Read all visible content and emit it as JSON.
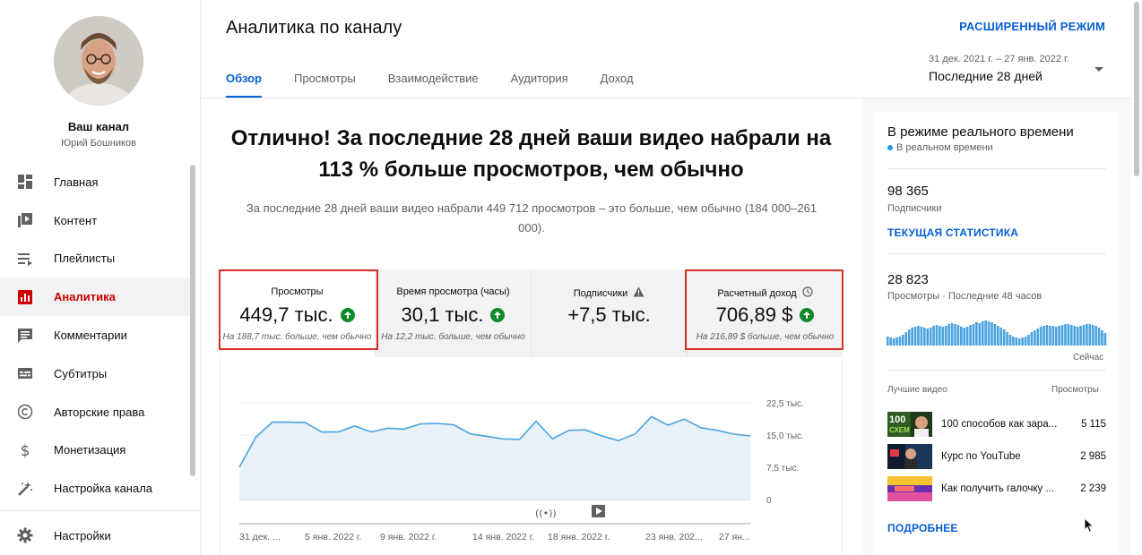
{
  "channel": {
    "title": "Ваш канал",
    "owner": "Юрий Бошников"
  },
  "sidebar": {
    "items": [
      {
        "label": "Главная",
        "icon": "dashboard-icon"
      },
      {
        "label": "Контент",
        "icon": "video-library-icon"
      },
      {
        "label": "Плейлисты",
        "icon": "playlist-icon"
      },
      {
        "label": "Аналитика",
        "icon": "analytics-icon",
        "active": true
      },
      {
        "label": "Комментарии",
        "icon": "comment-icon"
      },
      {
        "label": "Субтитры",
        "icon": "subtitles-icon"
      },
      {
        "label": "Авторские права",
        "icon": "copyright-icon"
      },
      {
        "label": "Монетизация",
        "icon": "dollar-icon"
      },
      {
        "label": "Настройка канала",
        "icon": "magic-wand-icon"
      }
    ],
    "settings_label": "Настройки"
  },
  "header": {
    "title": "Аналитика по каналу",
    "advanced_mode": "РАСШИРЕННЫЙ РЕЖИМ",
    "tabs": [
      "Обзор",
      "Просмотры",
      "Взаимодействие",
      "Аудитория",
      "Доход"
    ],
    "date_range": "31 дек. 2021 г. – 27 янв. 2022 г.",
    "date_preset": "Последние 28 дней"
  },
  "summary": {
    "headline": "Отлично! За последние 28 дней ваши видео набрали на 113 % больше просмотров, чем обычно",
    "subline": "За последние 28 дней ваши видео набрали 449 712 просмотров – это больше, чем обычно (184 000–261 000)."
  },
  "metrics": [
    {
      "title": "Просмотры",
      "value": "449,7 тыс.",
      "note": "На 188,7 тыс. больше, чем обычно",
      "trend": "up"
    },
    {
      "title": "Время просмотра (часы)",
      "value": "30,1 тыс.",
      "note": "На 12,2 тыс. больше, чем обычно",
      "trend": "up"
    },
    {
      "title": "Подписчики",
      "value": "+7,5 тыс.",
      "note": "",
      "trend": "none",
      "icon": "warning-icon"
    },
    {
      "title": "Расчетный доход",
      "value": "706,89 $",
      "note": "На 216,89 $ больше, чем обычно",
      "trend": "up",
      "icon": "clock-icon"
    }
  ],
  "chart_data": {
    "type": "area",
    "x": [
      "31 дек. ...",
      "5 янв. 2022 г.",
      "9 янв. 2022 г.",
      "14 янв. 2022 г.",
      "18 янв. 2022 г.",
      "23 янв. 202...",
      "27 ян..."
    ],
    "y_ticks": [
      "22,5 тыс.",
      "15,0 тыс.",
      "7,5 тыс.",
      "0"
    ],
    "ylim": [
      0,
      22500
    ],
    "series": [
      {
        "values": [
          7500,
          14500,
          18000,
          18000,
          17900,
          15700,
          15700,
          17100,
          15700,
          16600,
          16400,
          17600,
          17700,
          17400,
          15300,
          14700,
          14100,
          14000,
          18200,
          14100,
          16100,
          16200,
          14800,
          13700,
          15200,
          19300,
          17300,
          18700,
          16700,
          16100,
          15200,
          14800
        ],
        "color": "#4aa3df"
      }
    ],
    "grid": true
  },
  "realtime": {
    "title": "В режиме реального времени",
    "live_label": "В реальном времени",
    "subscribers_value": "98 365",
    "subscribers_label": "Подписчики",
    "current_stats_link": "ТЕКУЩАЯ СТАТИСТИКА",
    "views_value": "28 823",
    "views_label": "Просмотры · Последние 48 часов",
    "now_label": "Сейчас",
    "bars": [
      10,
      9,
      8,
      9,
      10,
      12,
      15,
      18,
      20,
      21,
      22,
      21,
      20,
      19,
      20,
      22,
      23,
      22,
      21,
      22,
      24,
      25,
      24,
      23,
      21,
      20,
      21,
      23,
      24,
      26,
      25,
      27,
      28,
      27,
      26,
      24,
      22,
      20,
      18,
      15,
      12,
      10,
      9,
      8,
      9,
      10,
      12,
      15,
      17,
      19,
      21,
      22,
      23,
      22,
      22,
      21,
      22,
      23,
      24,
      24,
      23,
      22,
      21,
      22,
      23,
      24,
      24,
      23,
      22,
      20,
      17,
      14
    ],
    "top_videos_label": "Лучшие видео",
    "views_col_label": "Просмотры",
    "top_videos": [
      {
        "title": "100 способов как зара...",
        "views": "5 115"
      },
      {
        "title": "Курс по YouTube",
        "views": "2 985"
      },
      {
        "title": "Как получить галочку ...",
        "views": "2 239"
      }
    ],
    "more_link": "ПОДРОБНЕЕ"
  }
}
